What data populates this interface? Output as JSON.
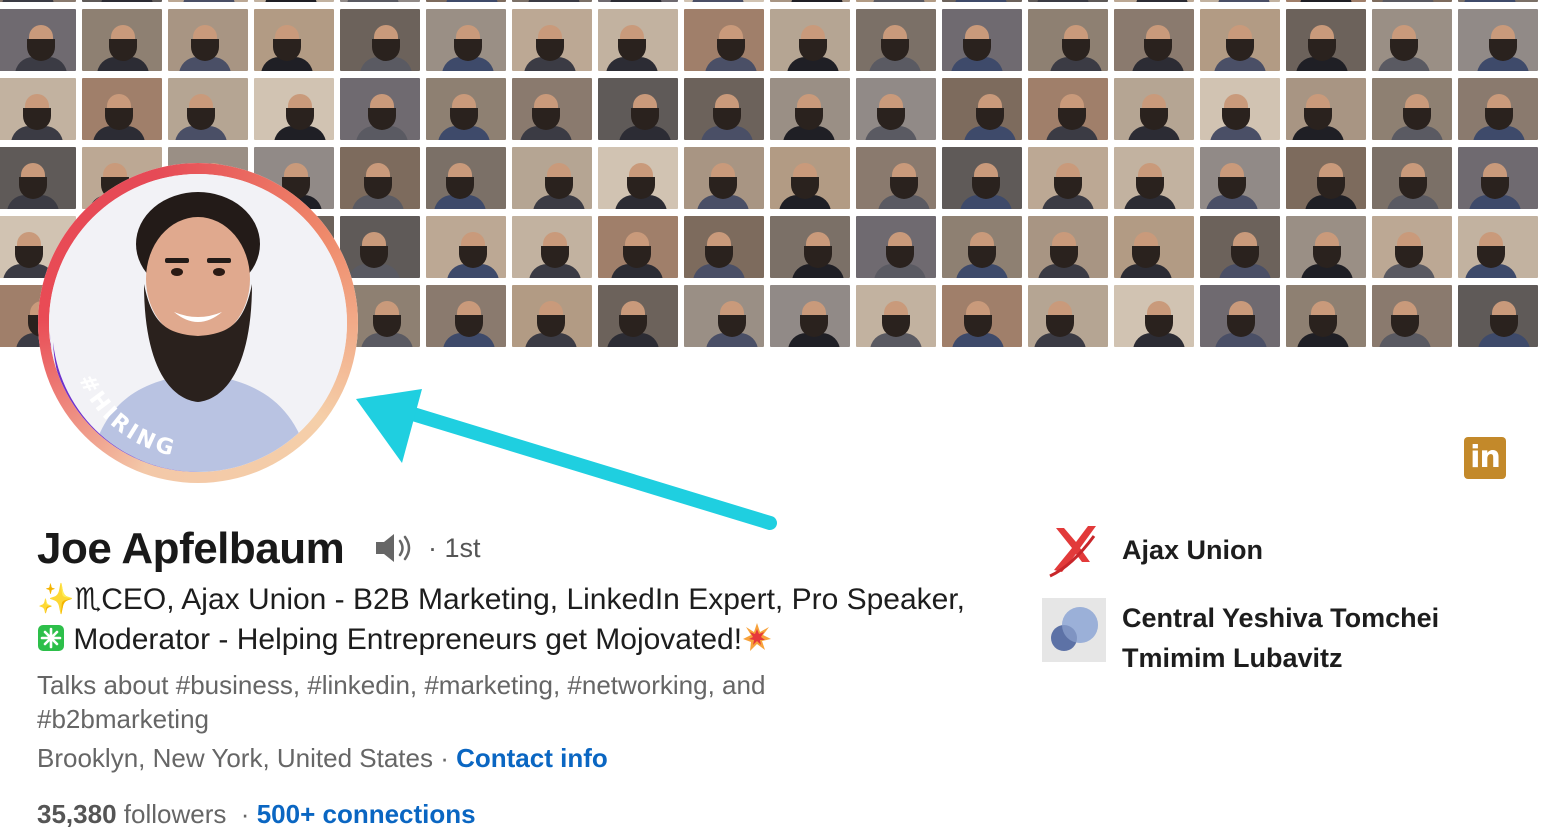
{
  "profile": {
    "name": "Joe Apfelbaum",
    "degree": "· 1st",
    "headline_prefix": "✨♏CEO, Ajax Union - B2B Marketing, LinkedIn Expert, Pro Speaker,",
    "headline_middle": "Moderator - Helping Entrepreneurs get Mojovated!",
    "talks_about": "Talks about #business, #linkedin, #marketing, #networking, and #b2bmarketing",
    "location": "Brooklyn, New York, United States",
    "location_separator": " · ",
    "contact_info_label": "Contact info",
    "followers_count": "35,380",
    "followers_label": " followers",
    "connections_separator": "  · ",
    "connections_label": "500+ connections",
    "frame_text": "#HIRING"
  },
  "badge": {
    "label": "in",
    "color": "#c3892a"
  },
  "companies": [
    {
      "name": "Ajax Union",
      "icon": "ajax-union-logo"
    },
    {
      "name": "Central Yeshiva Tomchei Tmimim Lubavitz",
      "icon": "school-logo"
    }
  ],
  "colors": {
    "link": "#0a66c2",
    "hiring_purple": "#7a3fd8",
    "arrow": "#1fcfe0"
  },
  "icons": {
    "speaker": "speaker-icon",
    "arrow": "arrow-annotation",
    "linkedin": "linkedin-icon"
  }
}
